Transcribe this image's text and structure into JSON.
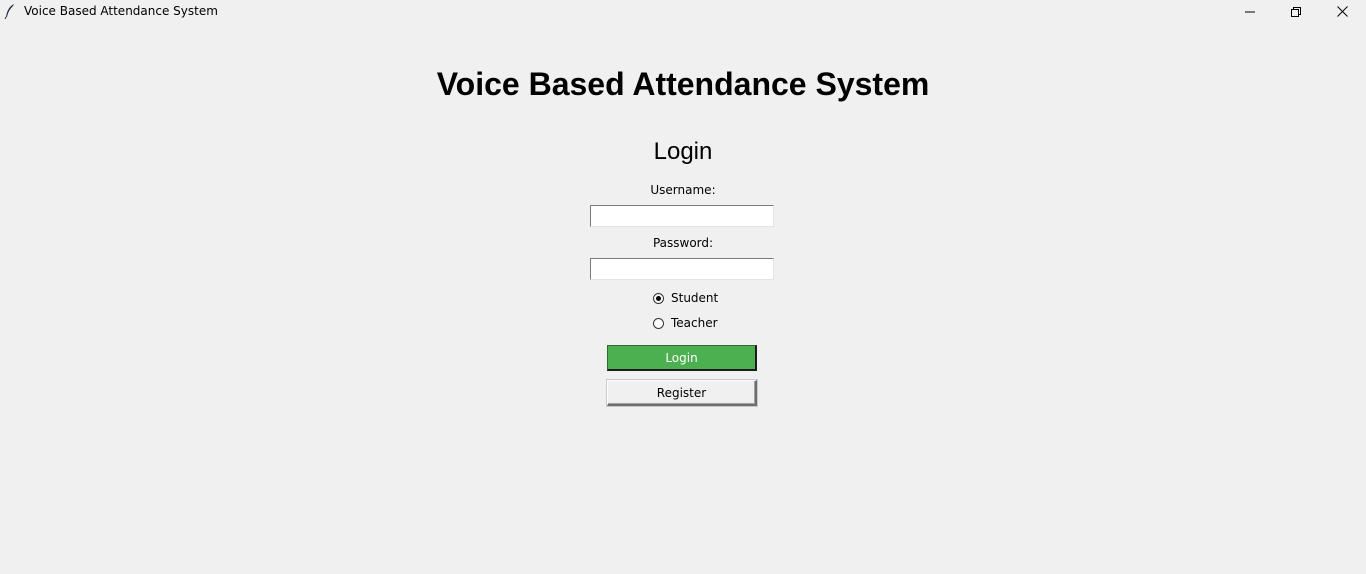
{
  "window": {
    "title": "Voice Based Attendance System",
    "icon": "feather-icon",
    "controls": [
      "minimize-icon",
      "restore-icon",
      "close-icon"
    ]
  },
  "main": {
    "heading": "Voice Based Attendance System",
    "login_title": "Login",
    "username_label": "Username:",
    "username_value": "",
    "password_label": "Password:",
    "password_value": "",
    "roles": [
      {
        "label": "Student",
        "selected": true
      },
      {
        "label": "Teacher",
        "selected": false
      }
    ],
    "login_button": "Login",
    "register_button": "Register"
  },
  "colors": {
    "background": "#f0f0f0",
    "login_button_bg": "#4caf50",
    "login_button_text": "#ffffff"
  }
}
